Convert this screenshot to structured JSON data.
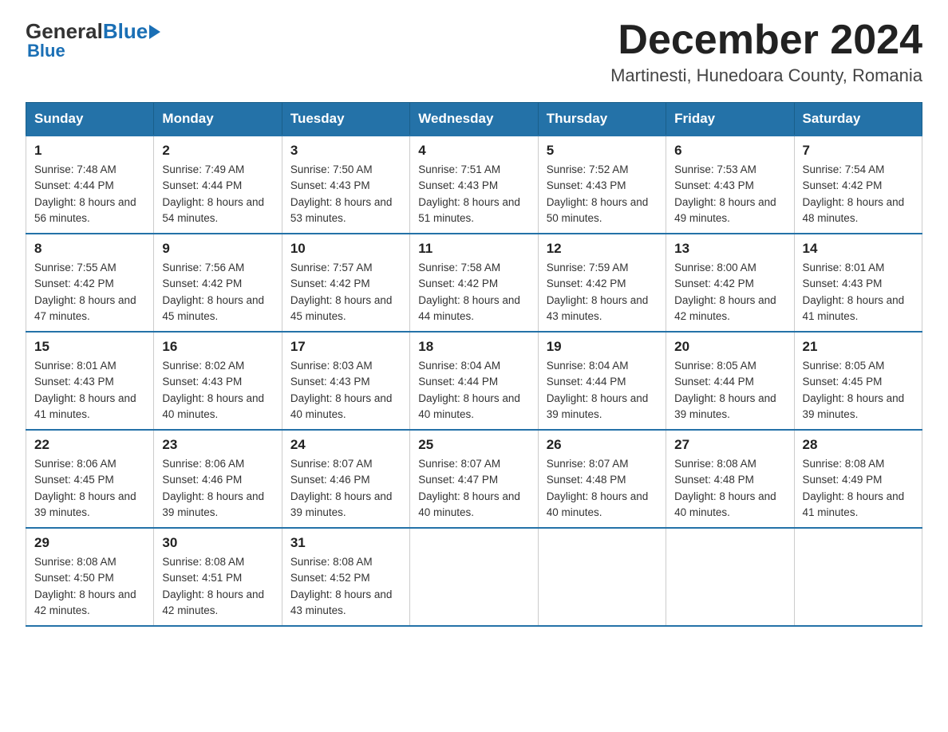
{
  "header": {
    "logo_general": "General",
    "logo_blue": "Blue",
    "month_title": "December 2024",
    "location": "Martinesti, Hunedoara County, Romania"
  },
  "weekdays": [
    "Sunday",
    "Monday",
    "Tuesday",
    "Wednesday",
    "Thursday",
    "Friday",
    "Saturday"
  ],
  "weeks": [
    [
      {
        "day": "1",
        "sunrise": "Sunrise: 7:48 AM",
        "sunset": "Sunset: 4:44 PM",
        "daylight": "Daylight: 8 hours and 56 minutes."
      },
      {
        "day": "2",
        "sunrise": "Sunrise: 7:49 AM",
        "sunset": "Sunset: 4:44 PM",
        "daylight": "Daylight: 8 hours and 54 minutes."
      },
      {
        "day": "3",
        "sunrise": "Sunrise: 7:50 AM",
        "sunset": "Sunset: 4:43 PM",
        "daylight": "Daylight: 8 hours and 53 minutes."
      },
      {
        "day": "4",
        "sunrise": "Sunrise: 7:51 AM",
        "sunset": "Sunset: 4:43 PM",
        "daylight": "Daylight: 8 hours and 51 minutes."
      },
      {
        "day": "5",
        "sunrise": "Sunrise: 7:52 AM",
        "sunset": "Sunset: 4:43 PM",
        "daylight": "Daylight: 8 hours and 50 minutes."
      },
      {
        "day": "6",
        "sunrise": "Sunrise: 7:53 AM",
        "sunset": "Sunset: 4:43 PM",
        "daylight": "Daylight: 8 hours and 49 minutes."
      },
      {
        "day": "7",
        "sunrise": "Sunrise: 7:54 AM",
        "sunset": "Sunset: 4:42 PM",
        "daylight": "Daylight: 8 hours and 48 minutes."
      }
    ],
    [
      {
        "day": "8",
        "sunrise": "Sunrise: 7:55 AM",
        "sunset": "Sunset: 4:42 PM",
        "daylight": "Daylight: 8 hours and 47 minutes."
      },
      {
        "day": "9",
        "sunrise": "Sunrise: 7:56 AM",
        "sunset": "Sunset: 4:42 PM",
        "daylight": "Daylight: 8 hours and 45 minutes."
      },
      {
        "day": "10",
        "sunrise": "Sunrise: 7:57 AM",
        "sunset": "Sunset: 4:42 PM",
        "daylight": "Daylight: 8 hours and 45 minutes."
      },
      {
        "day": "11",
        "sunrise": "Sunrise: 7:58 AM",
        "sunset": "Sunset: 4:42 PM",
        "daylight": "Daylight: 8 hours and 44 minutes."
      },
      {
        "day": "12",
        "sunrise": "Sunrise: 7:59 AM",
        "sunset": "Sunset: 4:42 PM",
        "daylight": "Daylight: 8 hours and 43 minutes."
      },
      {
        "day": "13",
        "sunrise": "Sunrise: 8:00 AM",
        "sunset": "Sunset: 4:42 PM",
        "daylight": "Daylight: 8 hours and 42 minutes."
      },
      {
        "day": "14",
        "sunrise": "Sunrise: 8:01 AM",
        "sunset": "Sunset: 4:43 PM",
        "daylight": "Daylight: 8 hours and 41 minutes."
      }
    ],
    [
      {
        "day": "15",
        "sunrise": "Sunrise: 8:01 AM",
        "sunset": "Sunset: 4:43 PM",
        "daylight": "Daylight: 8 hours and 41 minutes."
      },
      {
        "day": "16",
        "sunrise": "Sunrise: 8:02 AM",
        "sunset": "Sunset: 4:43 PM",
        "daylight": "Daylight: 8 hours and 40 minutes."
      },
      {
        "day": "17",
        "sunrise": "Sunrise: 8:03 AM",
        "sunset": "Sunset: 4:43 PM",
        "daylight": "Daylight: 8 hours and 40 minutes."
      },
      {
        "day": "18",
        "sunrise": "Sunrise: 8:04 AM",
        "sunset": "Sunset: 4:44 PM",
        "daylight": "Daylight: 8 hours and 40 minutes."
      },
      {
        "day": "19",
        "sunrise": "Sunrise: 8:04 AM",
        "sunset": "Sunset: 4:44 PM",
        "daylight": "Daylight: 8 hours and 39 minutes."
      },
      {
        "day": "20",
        "sunrise": "Sunrise: 8:05 AM",
        "sunset": "Sunset: 4:44 PM",
        "daylight": "Daylight: 8 hours and 39 minutes."
      },
      {
        "day": "21",
        "sunrise": "Sunrise: 8:05 AM",
        "sunset": "Sunset: 4:45 PM",
        "daylight": "Daylight: 8 hours and 39 minutes."
      }
    ],
    [
      {
        "day": "22",
        "sunrise": "Sunrise: 8:06 AM",
        "sunset": "Sunset: 4:45 PM",
        "daylight": "Daylight: 8 hours and 39 minutes."
      },
      {
        "day": "23",
        "sunrise": "Sunrise: 8:06 AM",
        "sunset": "Sunset: 4:46 PM",
        "daylight": "Daylight: 8 hours and 39 minutes."
      },
      {
        "day": "24",
        "sunrise": "Sunrise: 8:07 AM",
        "sunset": "Sunset: 4:46 PM",
        "daylight": "Daylight: 8 hours and 39 minutes."
      },
      {
        "day": "25",
        "sunrise": "Sunrise: 8:07 AM",
        "sunset": "Sunset: 4:47 PM",
        "daylight": "Daylight: 8 hours and 40 minutes."
      },
      {
        "day": "26",
        "sunrise": "Sunrise: 8:07 AM",
        "sunset": "Sunset: 4:48 PM",
        "daylight": "Daylight: 8 hours and 40 minutes."
      },
      {
        "day": "27",
        "sunrise": "Sunrise: 8:08 AM",
        "sunset": "Sunset: 4:48 PM",
        "daylight": "Daylight: 8 hours and 40 minutes."
      },
      {
        "day": "28",
        "sunrise": "Sunrise: 8:08 AM",
        "sunset": "Sunset: 4:49 PM",
        "daylight": "Daylight: 8 hours and 41 minutes."
      }
    ],
    [
      {
        "day": "29",
        "sunrise": "Sunrise: 8:08 AM",
        "sunset": "Sunset: 4:50 PM",
        "daylight": "Daylight: 8 hours and 42 minutes."
      },
      {
        "day": "30",
        "sunrise": "Sunrise: 8:08 AM",
        "sunset": "Sunset: 4:51 PM",
        "daylight": "Daylight: 8 hours and 42 minutes."
      },
      {
        "day": "31",
        "sunrise": "Sunrise: 8:08 AM",
        "sunset": "Sunset: 4:52 PM",
        "daylight": "Daylight: 8 hours and 43 minutes."
      },
      {
        "day": "",
        "sunrise": "",
        "sunset": "",
        "daylight": ""
      },
      {
        "day": "",
        "sunrise": "",
        "sunset": "",
        "daylight": ""
      },
      {
        "day": "",
        "sunrise": "",
        "sunset": "",
        "daylight": ""
      },
      {
        "day": "",
        "sunrise": "",
        "sunset": "",
        "daylight": ""
      }
    ]
  ]
}
